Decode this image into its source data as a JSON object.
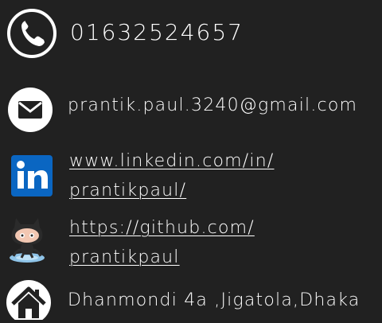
{
  "contact": {
    "phone": {
      "icon": "phone-icon",
      "text": "01632524657"
    },
    "email": {
      "icon": "email-icon",
      "text": "prantik.paul.3240@gmail.com"
    },
    "linkedin": {
      "icon": "linkedin-icon",
      "line1": "www.linkedin.com/in/",
      "line2": "prantikpaul/"
    },
    "github": {
      "icon": "github-octocat-icon",
      "line1": "https://github.com/",
      "line2": "prantikpaul"
    },
    "address": {
      "icon": "home-icon",
      "text": "Dhanmondi 4a ,Jigatola,Dhaka"
    }
  },
  "colors": {
    "background": "#212121",
    "text": "#ffffff",
    "linkedin_blue": "#0a66c2"
  }
}
